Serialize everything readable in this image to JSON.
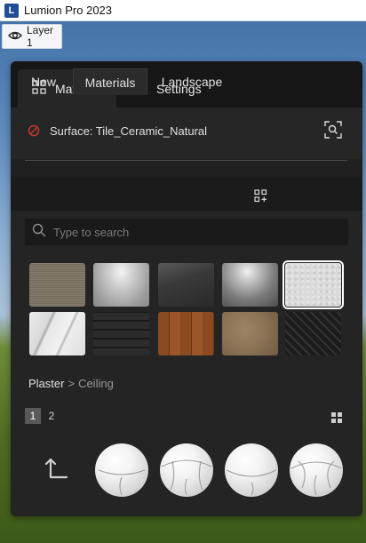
{
  "window": {
    "title": "Lumion Pro 2023",
    "icon_letter": "L"
  },
  "layer": {
    "label": "Layer 1",
    "icon": "eye-icon"
  },
  "panel": {
    "tabs": [
      {
        "label": "Materials",
        "icon": "grid-icon",
        "active": true
      },
      {
        "label": "Settings",
        "icon": "pencil-icon",
        "active": false
      }
    ],
    "surface_label": "Surface: Tile_Ceramic_Natural",
    "sub_tabs": [
      {
        "label": "New",
        "active": false
      },
      {
        "label": "Materials",
        "active": true
      },
      {
        "label": "Landscape",
        "active": false
      }
    ],
    "search": {
      "placeholder": "Type to search",
      "value": ""
    },
    "materials": [
      {
        "name": "fabric-linen-thumbnail",
        "selected": false
      },
      {
        "name": "glass-frosted-thumbnail",
        "selected": false
      },
      {
        "name": "glass-dark-thumbnail",
        "selected": false
      },
      {
        "name": "metal-brushed-thumbnail",
        "selected": false
      },
      {
        "name": "plaster-ceiling-thumbnail",
        "selected": true
      },
      {
        "name": "marble-white-thumbnail",
        "selected": false
      },
      {
        "name": "roof-tile-thumbnail",
        "selected": false
      },
      {
        "name": "wood-planks-thumbnail",
        "selected": false
      },
      {
        "name": "stone-sandstone-thumbnail",
        "selected": false
      },
      {
        "name": "floor-herringbone-thumbnail",
        "selected": false
      }
    ],
    "breadcrumb": {
      "category": "Plaster",
      "separator": ">",
      "subcategory": "Ceiling"
    },
    "pages": [
      {
        "label": "1",
        "active": true
      },
      {
        "label": "2",
        "active": false
      }
    ],
    "variant_count": 4
  },
  "colors": {
    "panel_bg": "#202020",
    "selection_outline": "#ffffff",
    "no_entry_red": "#c0392b"
  }
}
